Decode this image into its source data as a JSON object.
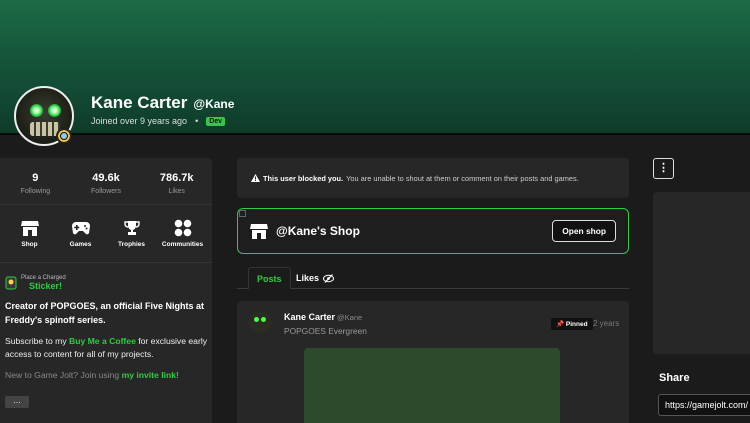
{
  "profile": {
    "display_name": "Kane Carter",
    "username": "@Kane",
    "joined": "Joined over 9 years ago",
    "separator": "•",
    "badge": "Dev"
  },
  "stats": [
    {
      "value": "9",
      "label": "Following"
    },
    {
      "value": "49.6k",
      "label": "Followers"
    },
    {
      "value": "786.7k",
      "label": "Likes"
    }
  ],
  "quicklinks": [
    {
      "label": "Shop",
      "icon": "shop-icon"
    },
    {
      "label": "Games",
      "icon": "gamepad-icon"
    },
    {
      "label": "Trophies",
      "icon": "trophy-icon"
    },
    {
      "label": "Communities",
      "icon": "communities-icon"
    }
  ],
  "sticker": {
    "line1": "Place a Charged",
    "line2": "Sticker!"
  },
  "bio": {
    "headline": "Creator of POPGOES, an official Five Nights at Freddy's spinoff series.",
    "sub_prefix": "Subscribe to my ",
    "sub_link": "Buy Me a Coffee",
    "sub_suffix": " for exclusive early access to content for all of my projects.",
    "invite_prefix": "New to Game Jolt? Join using ",
    "invite_link": "my invite link!",
    "more": "…"
  },
  "blocked": {
    "bold": "This user blocked you.",
    "rest": "You are unable to shout at them or comment on their posts and games."
  },
  "shop": {
    "title": "@Kane's Shop",
    "button": "Open shop"
  },
  "tabs": {
    "posts": "Posts",
    "likes": "Likes"
  },
  "post": {
    "author": "Kane Carter",
    "author_username": "@Kane",
    "game": "POPGOES Evergreen",
    "pinned": "Pinned",
    "age": "2 years"
  },
  "menu": {
    "more_label": "⋮"
  },
  "share": {
    "title": "Share",
    "url": "https://gamejolt.com/"
  },
  "colors": {
    "accent": "#2ecc40",
    "banner": "#1d6b45",
    "panel": "#272727",
    "background": "#1b1b1b"
  }
}
